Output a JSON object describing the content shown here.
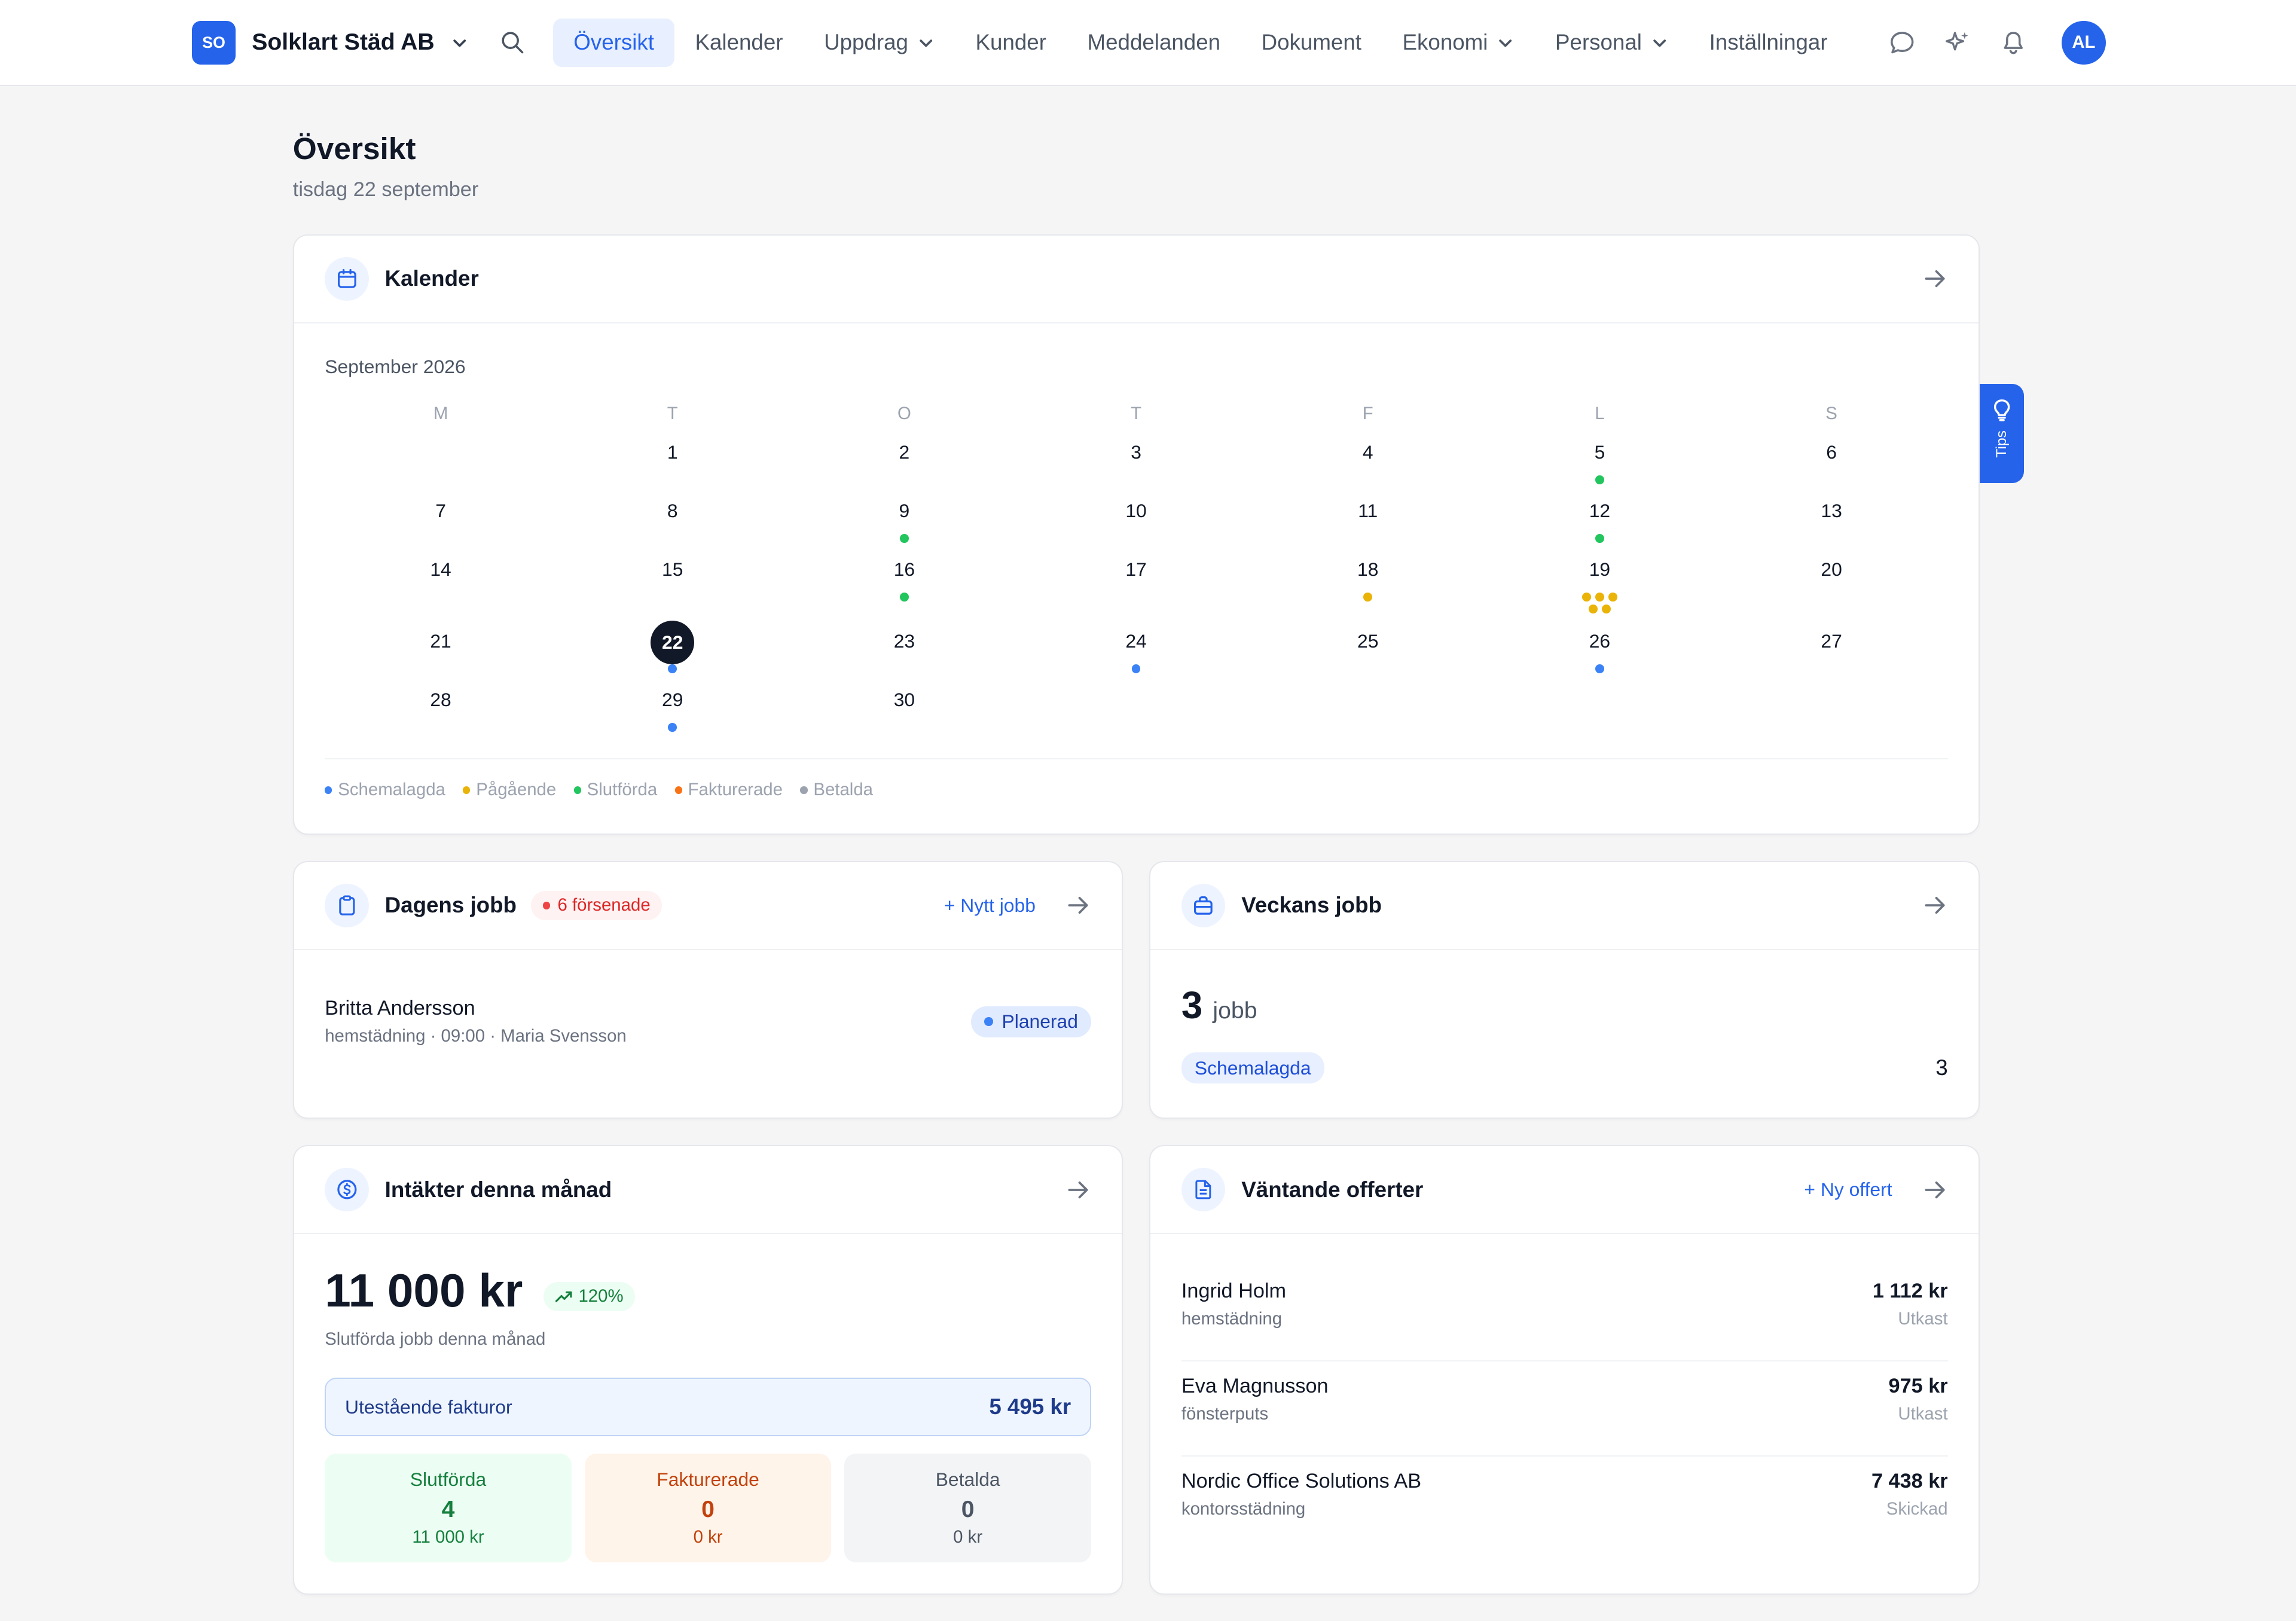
{
  "app": {
    "logo_initials": "SO",
    "company_name": "Solklart Städ AB",
    "avatar_initials": "AL",
    "accent_color": "#2563eb"
  },
  "nav": {
    "items": [
      {
        "label": "Översikt",
        "active": true,
        "dropdown": false
      },
      {
        "label": "Kalender",
        "active": false,
        "dropdown": false
      },
      {
        "label": "Uppdrag",
        "active": false,
        "dropdown": true
      },
      {
        "label": "Kunder",
        "active": false,
        "dropdown": false
      },
      {
        "label": "Meddelanden",
        "active": false,
        "dropdown": false
      },
      {
        "label": "Dokument",
        "active": false,
        "dropdown": false
      },
      {
        "label": "Ekonomi",
        "active": false,
        "dropdown": true
      },
      {
        "label": "Personal",
        "active": false,
        "dropdown": true
      },
      {
        "label": "Inställningar",
        "active": false,
        "dropdown": false
      }
    ],
    "right_icons": [
      "chat-icon",
      "sparkles-icon",
      "bell-icon"
    ]
  },
  "page": {
    "title": "Översikt",
    "subtitle": "tisdag 22 september"
  },
  "tips": {
    "label": "Tips"
  },
  "calendar": {
    "title": "Kalender",
    "month_label": "September 2026",
    "weekdays": [
      "M",
      "T",
      "O",
      "T",
      "F",
      "L",
      "S"
    ],
    "today": 22,
    "weeks": [
      [
        null,
        {
          "d": "1",
          "dots": []
        },
        {
          "d": "2",
          "dots": []
        },
        {
          "d": "3",
          "dots": []
        },
        {
          "d": "4",
          "dots": []
        },
        {
          "d": "5",
          "dots": [
            "green"
          ]
        },
        {
          "d": "6",
          "dots": []
        }
      ],
      [
        {
          "d": "7",
          "dots": []
        },
        {
          "d": "8",
          "dots": []
        },
        {
          "d": "9",
          "dots": [
            "green"
          ]
        },
        {
          "d": "10",
          "dots": []
        },
        {
          "d": "11",
          "dots": []
        },
        {
          "d": "12",
          "dots": [
            "green"
          ]
        },
        {
          "d": "13",
          "dots": []
        }
      ],
      [
        {
          "d": "14",
          "dots": []
        },
        {
          "d": "15",
          "dots": []
        },
        {
          "d": "16",
          "dots": [
            "green"
          ]
        },
        {
          "d": "17",
          "dots": []
        },
        {
          "d": "18",
          "dots": [
            "yellow"
          ]
        },
        {
          "d": "19",
          "dots": [
            "yellow",
            "yellow",
            "yellow",
            "yellow",
            "yellow"
          ]
        },
        {
          "d": "20",
          "dots": []
        }
      ],
      [
        {
          "d": "21",
          "dots": []
        },
        {
          "d": "22",
          "dots": [
            "blue"
          ]
        },
        {
          "d": "23",
          "dots": []
        },
        {
          "d": "24",
          "dots": [
            "blue"
          ]
        },
        {
          "d": "25",
          "dots": []
        },
        {
          "d": "26",
          "dots": [
            "blue"
          ]
        },
        {
          "d": "27",
          "dots": []
        }
      ],
      [
        {
          "d": "28",
          "dots": []
        },
        {
          "d": "29",
          "dots": [
            "blue"
          ]
        },
        {
          "d": "30",
          "dots": []
        },
        null,
        null,
        null,
        null
      ]
    ],
    "legend": [
      {
        "label": "Schemalagda",
        "color": "#3b82f6"
      },
      {
        "label": "Pågående",
        "color": "#eab308"
      },
      {
        "label": "Slutförda",
        "color": "#22c55e"
      },
      {
        "label": "Fakturerade",
        "color": "#f97316"
      },
      {
        "label": "Betalda",
        "color": "#9ca3af"
      }
    ],
    "dot_colors": {
      "blue": "#3b82f6",
      "yellow": "#eab308",
      "green": "#22c55e",
      "orange": "#f97316",
      "grey": "#9ca3af"
    }
  },
  "today_jobs": {
    "title": "Dagens jobb",
    "late_badge": "6 försenade",
    "new_job": "+ Nytt jobb",
    "job": {
      "customer": "Britta Andersson",
      "meta": "hemstädning · 09:00 · Maria Svensson",
      "status": "Planerad"
    }
  },
  "week_jobs": {
    "title": "Veckans jobb",
    "count": "3",
    "unit": "jobb",
    "status_label": "Schemalagda",
    "status_count": "3"
  },
  "revenue": {
    "title": "Intäkter denna månad",
    "amount": "11 000 kr",
    "trend": "120%",
    "subtitle": "Slutförda jobb denna månad",
    "outstanding_label": "Utestående fakturor",
    "outstanding_value": "5 495 kr",
    "stats": [
      {
        "title": "Slutförda",
        "count": "4",
        "amount": "11 000 kr",
        "tone": "green"
      },
      {
        "title": "Fakturerade",
        "count": "0",
        "amount": "0 kr",
        "tone": "orange"
      },
      {
        "title": "Betalda",
        "count": "0",
        "amount": "0 kr",
        "tone": "grey"
      }
    ]
  },
  "offers": {
    "title": "Väntande offerter",
    "new_offer": "+ Ny offert",
    "items": [
      {
        "name": "Ingrid Holm",
        "service": "hemstädning",
        "amount": "1 112 kr",
        "status": "Utkast"
      },
      {
        "name": "Eva Magnusson",
        "service": "fönsterputs",
        "amount": "975 kr",
        "status": "Utkast"
      },
      {
        "name": "Nordic Office Solutions AB",
        "service": "kontorsstädning",
        "amount": "7 438 kr",
        "status": "Skickad"
      }
    ]
  }
}
